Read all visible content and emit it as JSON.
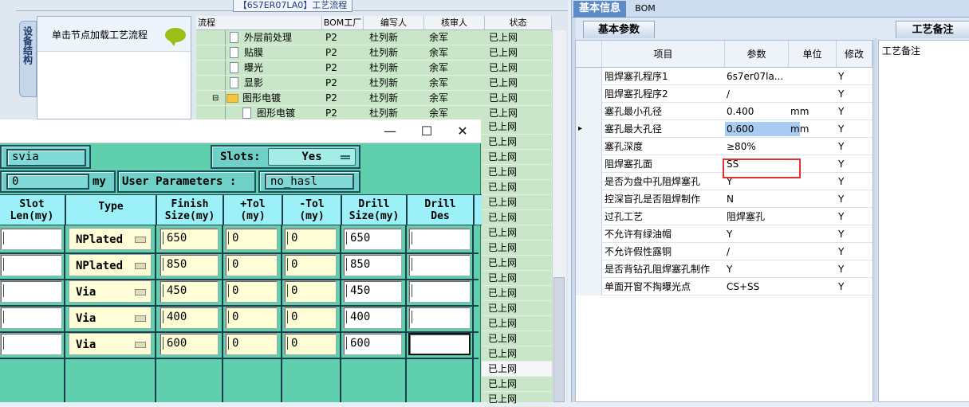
{
  "window_title": "【6S7ER07LA0】工艺流程",
  "tree": {
    "side_tab": "设备结构",
    "hint": "单击节点加载工艺流程"
  },
  "flow": {
    "headers": [
      "流程",
      "BOM工厂",
      "编写人",
      "核审人",
      "状态"
    ],
    "rows": [
      {
        "name": "外层前处理",
        "factory": "P2",
        "writer": "杜列新",
        "reviewer": "余军",
        "status": "已上网"
      },
      {
        "name": "贴膜",
        "factory": "P2",
        "writer": "杜列新",
        "reviewer": "余军",
        "status": "已上网"
      },
      {
        "name": "曝光",
        "factory": "P2",
        "writer": "杜列新",
        "reviewer": "余军",
        "status": "已上网"
      },
      {
        "name": "显影",
        "factory": "P2",
        "writer": "杜列新",
        "reviewer": "余军",
        "status": "已上网"
      },
      {
        "name": "图形电镀",
        "factory": "P2",
        "writer": "杜列新",
        "reviewer": "余军",
        "status": "已上网"
      },
      {
        "name": "图形电镀",
        "factory": "P2",
        "writer": "杜列新",
        "reviewer": "余军",
        "status": "已上网"
      }
    ],
    "status_only": "已上网"
  },
  "dialog": {
    "field1": "svia",
    "slots_label": "Slots:",
    "slots_value": "Yes",
    "field2": "0",
    "unit": "my",
    "user_params_label": "User Parameters :",
    "user_params_value": "no_hasl",
    "headers": [
      "Slot\nLen(my)",
      "Type",
      "Finish\nSize(my)",
      "+Tol\n(my)",
      "-Tol\n(my)",
      "Drill\nSize(my)",
      "Drill\nDes"
    ],
    "rows": [
      {
        "type": "NPlated",
        "finish": "650",
        "ptol": "0",
        "ntol": "0",
        "drill": "650"
      },
      {
        "type": "NPlated",
        "finish": "850",
        "ptol": "0",
        "ntol": "0",
        "drill": "850"
      },
      {
        "type": "Via",
        "finish": "450",
        "ptol": "0",
        "ntol": "0",
        "drill": "450"
      },
      {
        "type": "Via",
        "finish": "400",
        "ptol": "0",
        "ntol": "0",
        "drill": "400"
      },
      {
        "type": "Via",
        "finish": "600",
        "ptol": "0",
        "ntol": "0",
        "drill": "600"
      }
    ]
  },
  "right": {
    "tabs": [
      "基本信息",
      "BOM"
    ],
    "subtab": "基本参数",
    "notes_tab": "工艺备注",
    "notes_label": "工艺备注",
    "headers": [
      "项目",
      "参数",
      "单位",
      "修改"
    ],
    "rows": [
      {
        "item": "阻焊塞孔程序1",
        "param": "6s7er07la...",
        "unit": "",
        "mod": "Y"
      },
      {
        "item": "阻焊塞孔程序2",
        "param": "/",
        "unit": "",
        "mod": "Y"
      },
      {
        "item": "塞孔最小孔径",
        "param": "0.400",
        "unit": "mm",
        "mod": "Y"
      },
      {
        "item": "塞孔最大孔径",
        "param": "0.600",
        "unit": "mm",
        "mod": "Y"
      },
      {
        "item": "塞孔深度",
        "param": "≥80%",
        "unit": "",
        "mod": "Y"
      },
      {
        "item": "阻焊塞孔面",
        "param": "SS",
        "unit": "",
        "mod": "Y"
      },
      {
        "item": "是否为盘中孔阻焊塞孔",
        "param": "Y",
        "unit": "",
        "mod": "Y"
      },
      {
        "item": "控深盲孔是否阻焊制作",
        "param": "N",
        "unit": "",
        "mod": "Y"
      },
      {
        "item": "过孔工艺",
        "param": "阻焊塞孔",
        "unit": "",
        "mod": "Y"
      },
      {
        "item": "不允许有绿油帽",
        "param": "Y",
        "unit": "",
        "mod": "Y"
      },
      {
        "item": "不允许假性露铜",
        "param": "/",
        "unit": "",
        "mod": "Y"
      },
      {
        "item": "是否背钻孔阻焊塞孔制作",
        "param": "Y",
        "unit": "",
        "mod": "Y"
      },
      {
        "item": "单面开窗不掏曝光点",
        "param": "CS+SS",
        "unit": "",
        "mod": "Y"
      }
    ]
  }
}
